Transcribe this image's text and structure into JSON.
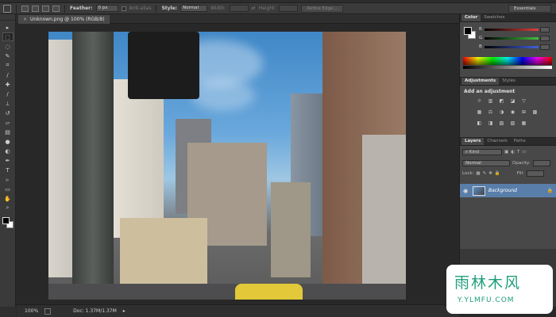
{
  "options_bar": {
    "feather_label": "Feather:",
    "feather_value": "0 px",
    "antialias_label": "Anti-alias",
    "style_label": "Style:",
    "style_value": "Normal",
    "width_label": "Width:",
    "height_label": "Height:",
    "refine_edge_label": "Refine Edge...",
    "workspace_label": "Essentials"
  },
  "document": {
    "tab_title": "Unknown.png @ 100% (RGB/8)",
    "tab_close": "×"
  },
  "status_bar": {
    "zoom": "100%",
    "doc_info": "Doc: 1.37M/1.37M"
  },
  "tools": [
    {
      "name": "move-tool-icon",
      "glyph": "▸"
    },
    {
      "name": "marquee-tool-icon",
      "glyph": "⬚"
    },
    {
      "name": "lasso-tool-icon",
      "glyph": "◌"
    },
    {
      "name": "quick-select-tool-icon",
      "glyph": "✎"
    },
    {
      "name": "crop-tool-icon",
      "glyph": "⌗"
    },
    {
      "name": "eyedropper-tool-icon",
      "glyph": "∕"
    },
    {
      "name": "healing-brush-tool-icon",
      "glyph": "✚"
    },
    {
      "name": "brush-tool-icon",
      "glyph": "∕"
    },
    {
      "name": "clone-stamp-tool-icon",
      "glyph": "⊥"
    },
    {
      "name": "history-brush-tool-icon",
      "glyph": "↺"
    },
    {
      "name": "eraser-tool-icon",
      "glyph": "▱"
    },
    {
      "name": "gradient-tool-icon",
      "glyph": "▤"
    },
    {
      "name": "blur-tool-icon",
      "glyph": "●"
    },
    {
      "name": "dodge-tool-icon",
      "glyph": "◐"
    },
    {
      "name": "pen-tool-icon",
      "glyph": "✒"
    },
    {
      "name": "type-tool-icon",
      "glyph": "T"
    },
    {
      "name": "path-select-tool-icon",
      "glyph": "▹"
    },
    {
      "name": "shape-tool-icon",
      "glyph": "▭"
    },
    {
      "name": "hand-tool-icon",
      "glyph": "✋"
    },
    {
      "name": "zoom-tool-icon",
      "glyph": "⌕"
    }
  ],
  "color_panel": {
    "tabs": [
      "Color",
      "Swatches"
    ],
    "channels": [
      {
        "label": "R",
        "color": "#e04040"
      },
      {
        "label": "G",
        "color": "#40c040"
      },
      {
        "label": "B",
        "color": "#4060e0"
      }
    ]
  },
  "adjustments_panel": {
    "tabs": [
      "Adjustments",
      "Styles"
    ],
    "title": "Add an adjustment",
    "row1": [
      "☼",
      "▥",
      "◩",
      "◪",
      "▽"
    ],
    "row2": [
      "▦",
      "⚖",
      "◑",
      "◉",
      "⊞",
      "▩"
    ],
    "row3": [
      "◧",
      "◨",
      "▧",
      "▨",
      "▦"
    ]
  },
  "layers_panel": {
    "tabs": [
      "Layers",
      "Channels",
      "Paths"
    ],
    "kind_label": "Kind",
    "blend_mode": "Normal",
    "opacity_label": "Opacity:",
    "lock_label": "Lock:",
    "fill_label": "Fill:",
    "layer_name": "Background"
  },
  "watermark": {
    "chinese_text": "雨林木风",
    "url_text": "Y.YLMFU.COM"
  },
  "colors": {
    "panel_bg": "#484848",
    "selected_layer": "#5a7eaa",
    "watermark_green": "#1f9e7a"
  }
}
